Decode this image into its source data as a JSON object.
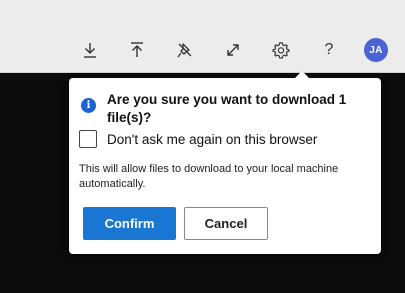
{
  "toolbar": {
    "icons": [
      "download-icon",
      "upload-icon",
      "unpin-icon",
      "expand-icon",
      "gear-icon",
      "help-icon"
    ],
    "help_label": "?",
    "avatar_initials": "JA",
    "avatar_color": "#4b63d6"
  },
  "dialog": {
    "title": "Are you sure you want to download 1 file(s)?",
    "info_glyph": "i",
    "checkbox_label": "Don't ask me again on this browser",
    "checkbox_checked": false,
    "description": "This will allow files to download to your local machine automatically.",
    "confirm_label": "Confirm",
    "cancel_label": "Cancel",
    "accent_color": "#1976d2"
  }
}
